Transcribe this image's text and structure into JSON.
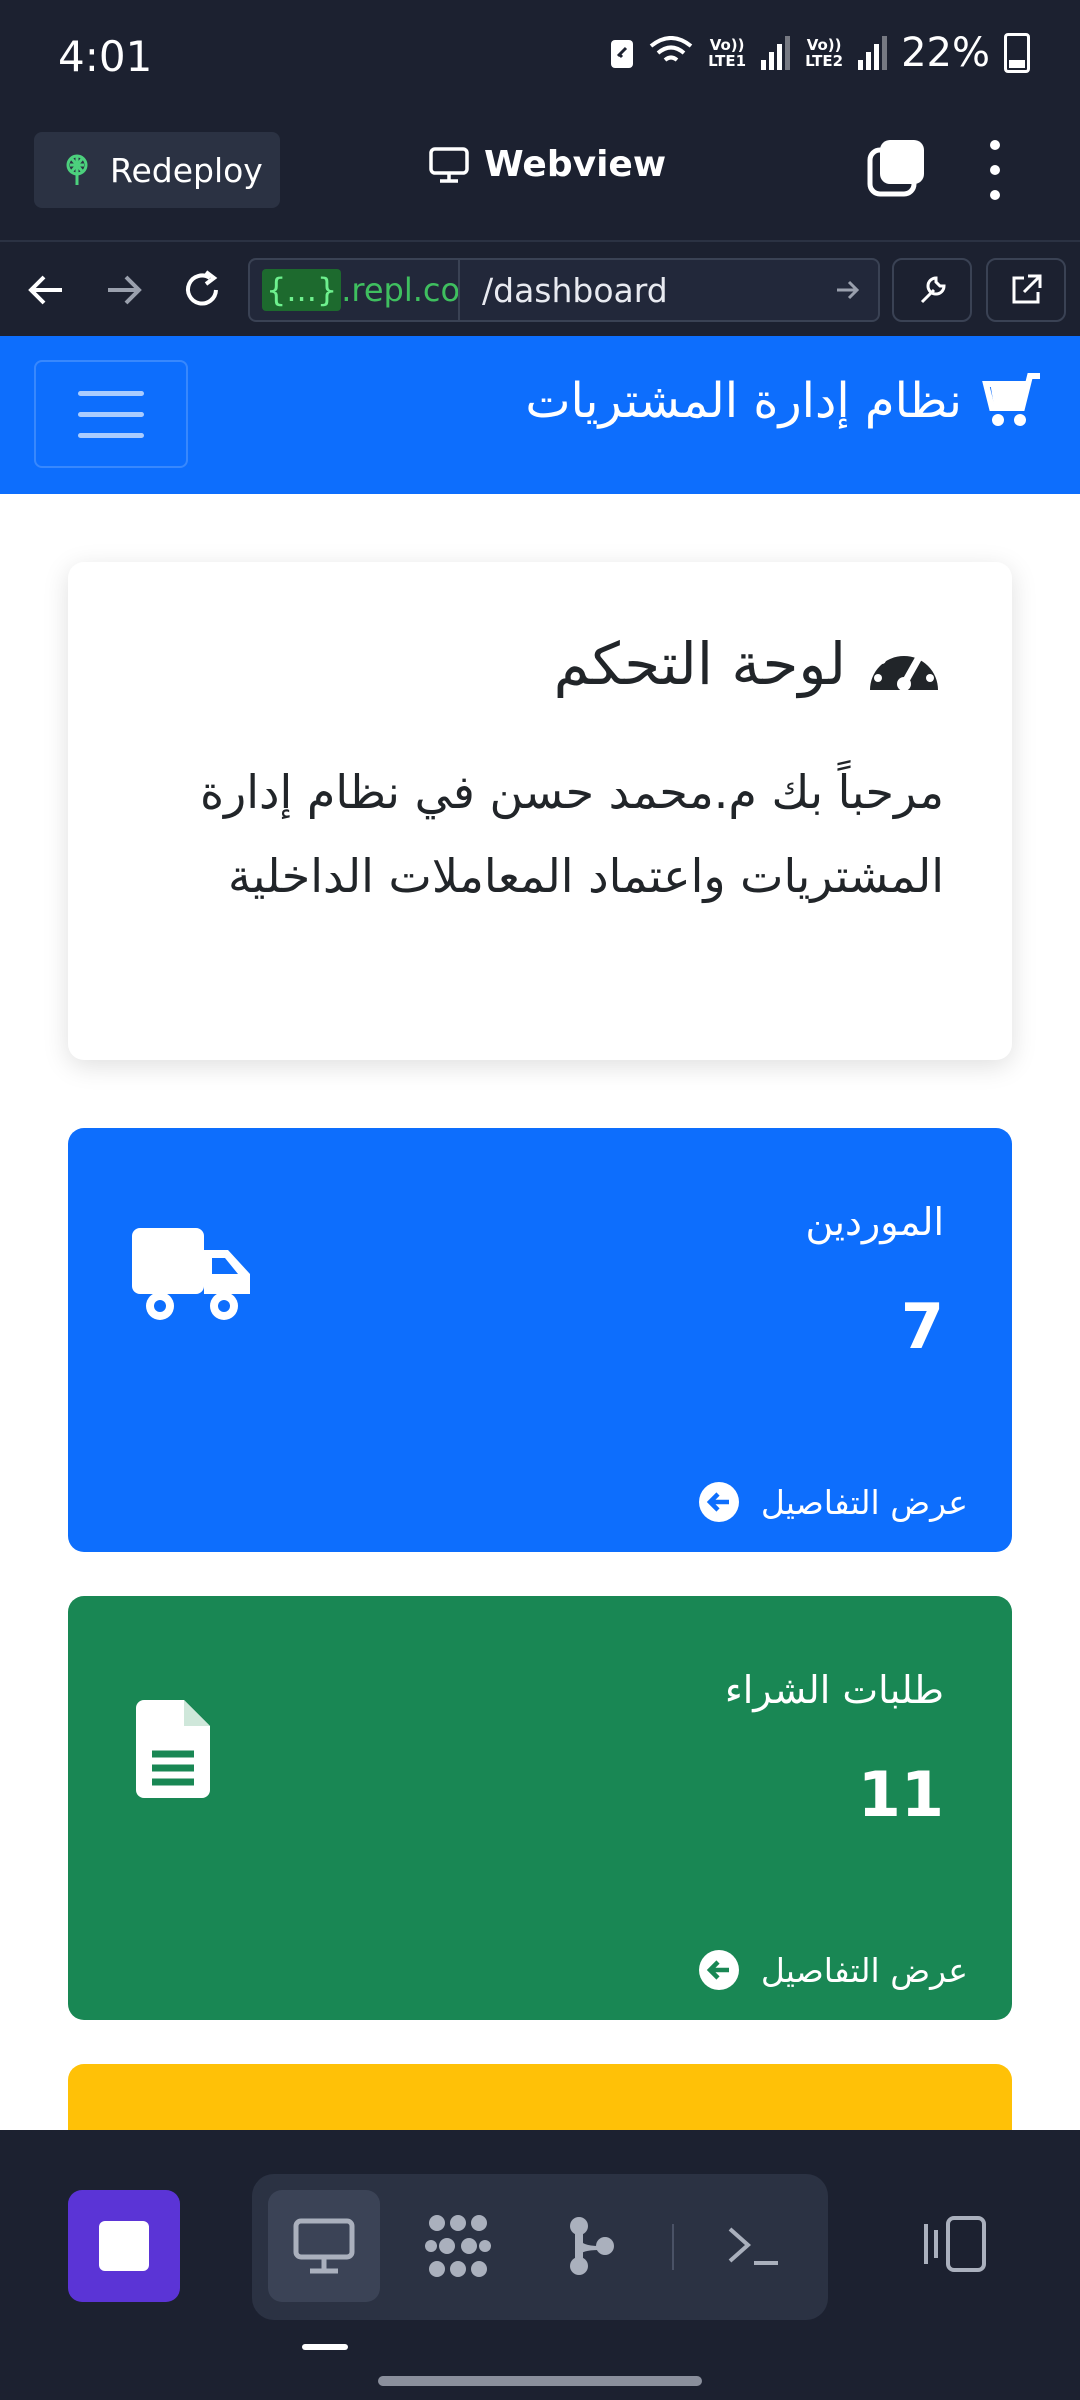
{
  "status_bar": {
    "time": "4:01",
    "sim1": "Vo)) LTE1",
    "sim2": "Vo)) LTE2",
    "battery": "22%"
  },
  "replit_header": {
    "redeploy_label": "Redeploy",
    "title": "Webview"
  },
  "url_bar": {
    "host": ".repl.co",
    "host_tag": "{...}",
    "path": "/dashboard"
  },
  "app": {
    "brand": "نظام إدارة المشتريات",
    "welcome_title": "لوحة التحكم",
    "welcome_text": "مرحباً بك م.محمد حسن في نظام إدارة المشتريات واعتماد المعاملات الداخلية",
    "cards": [
      {
        "label": "الموردين",
        "value": "7",
        "link": "عرض التفاصيل",
        "color": "#0d6efd",
        "icon": "truck-icon"
      },
      {
        "label": "طلبات الشراء",
        "value": "11",
        "link": "عرض التفاصيل",
        "color": "#198754",
        "icon": "file-text-icon"
      },
      {
        "label": "",
        "value": "",
        "link": "",
        "color": "#ffc107",
        "icon": ""
      }
    ]
  },
  "bottom_bar": {
    "tabs": [
      "monitor-icon",
      "packages-icon",
      "git-icon",
      "terminal-icon"
    ],
    "accent": "#5b34d6"
  }
}
